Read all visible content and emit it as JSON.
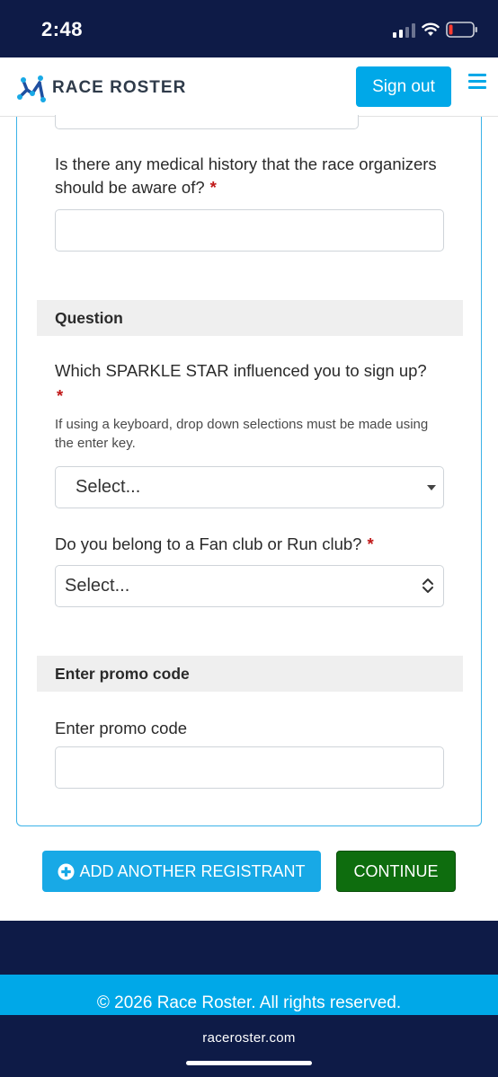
{
  "status_bar": {
    "time": "2:48",
    "signal_icon": "cellular-signal-icon",
    "wifi_icon": "wifi-icon",
    "battery_icon": "battery-low-icon"
  },
  "header": {
    "brand": "RACE ROSTER",
    "sign_out_label": "Sign out",
    "menu_icon": "hamburger-menu-icon",
    "accent_color": "#00a8e8"
  },
  "form": {
    "medical_question": {
      "label": "Is there any medical history that the race organizers should be aware of?",
      "required_mark": "*",
      "value": ""
    },
    "question_section": {
      "heading": "Question",
      "sparkle_question": {
        "label": "Which SPARKLE STAR influenced you to sign up?",
        "required_mark": "*",
        "helper": "If using a keyboard, drop down selections must be made using the enter key.",
        "selected": "Select..."
      },
      "club_question": {
        "label": "Do you belong to a Fan club or Run club?",
        "required_mark": "*",
        "selected": "Select..."
      }
    },
    "promo_section": {
      "heading": "Enter promo code",
      "label": "Enter promo code",
      "value": ""
    }
  },
  "actions": {
    "add_registrant_label": "ADD ANOTHER REGISTRANT",
    "add_icon": "plus-circle-icon",
    "continue_label": "CONTINUE",
    "continue_color": "#0e6d0e"
  },
  "footer": {
    "copyright": "© 2026 Race Roster. All rights reserved."
  },
  "browser": {
    "url": "raceroster.com"
  }
}
